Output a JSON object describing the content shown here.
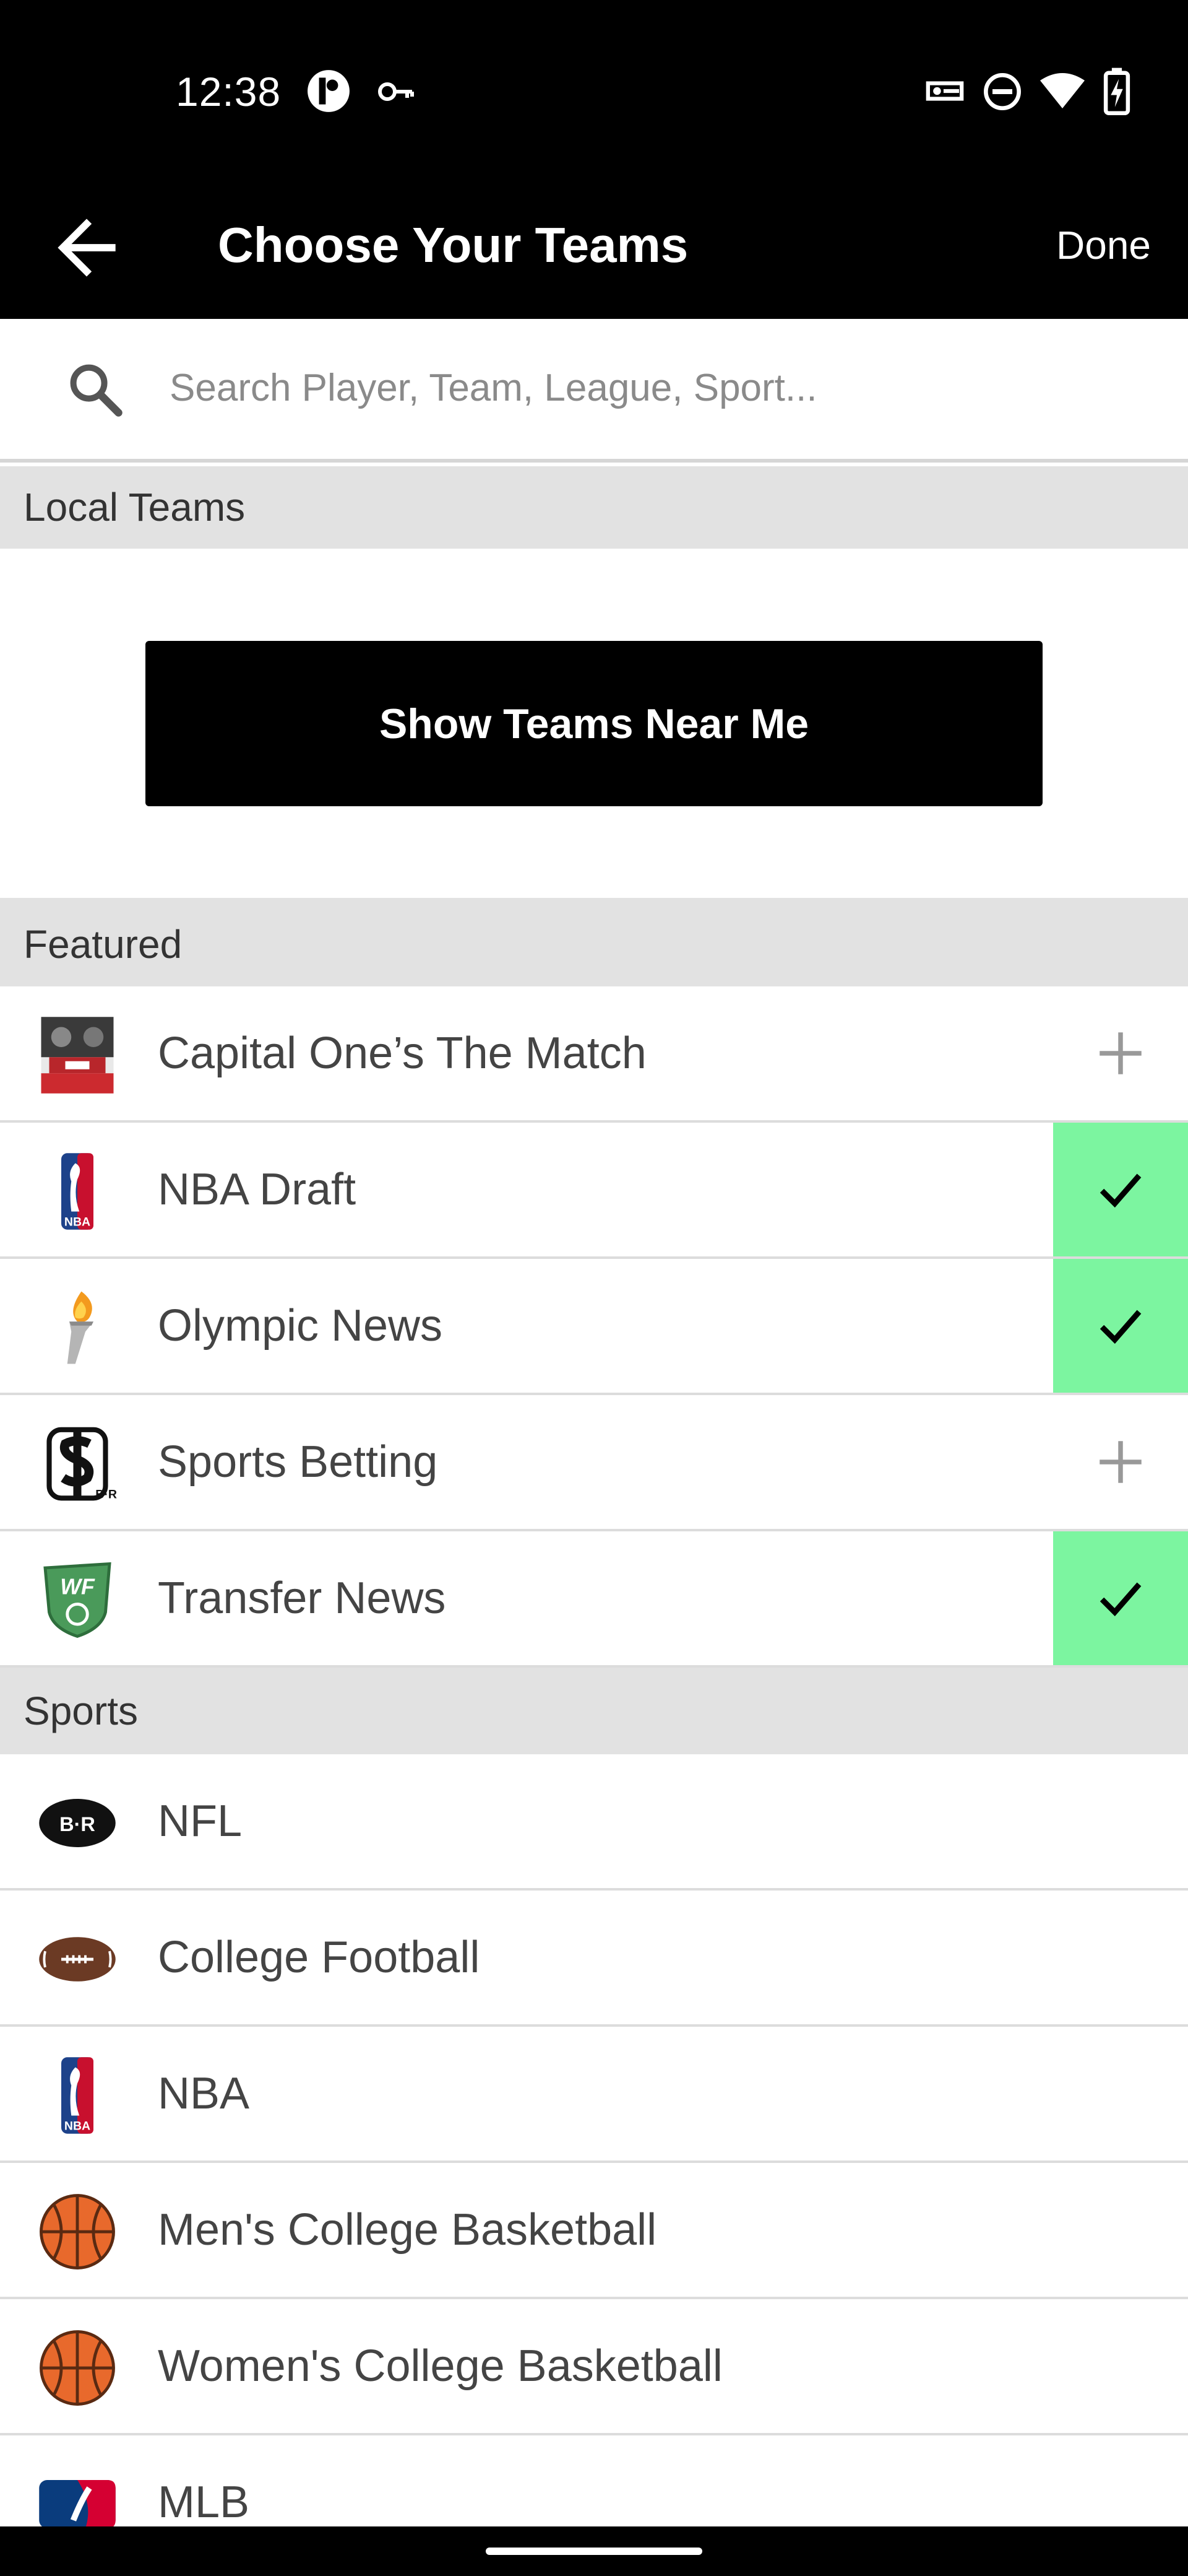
{
  "status_bar": {
    "time": "12:38"
  },
  "app_bar": {
    "title": "Choose Your Teams",
    "done_label": "Done"
  },
  "search": {
    "placeholder": "Search Player, Team, League, Sport..."
  },
  "local": {
    "header": "Local Teams",
    "button_label": "Show Teams Near Me"
  },
  "featured": {
    "header": "Featured",
    "items": [
      {
        "label": "Capital One’s The Match",
        "selected": false,
        "icon": "the-match-logo"
      },
      {
        "label": "NBA Draft",
        "selected": true,
        "icon": "nba-logo"
      },
      {
        "label": "Olympic News",
        "selected": true,
        "icon": "torch-icon"
      },
      {
        "label": "Sports Betting",
        "selected": false,
        "icon": "sports-betting-logo"
      },
      {
        "label": "Transfer News",
        "selected": true,
        "icon": "wf-shield-logo"
      }
    ]
  },
  "sports": {
    "header": "Sports",
    "items": [
      {
        "label": "NFL",
        "icon": "br-football-icon"
      },
      {
        "label": "College Football",
        "icon": "football-icon"
      },
      {
        "label": "NBA",
        "icon": "nba-logo"
      },
      {
        "label": "Men's College Basketball",
        "icon": "basketball-icon"
      },
      {
        "label": "Women's College Basketball",
        "icon": "basketball-icon"
      },
      {
        "label": "MLB",
        "icon": "mlb-logo"
      }
    ]
  },
  "colors": {
    "selected": "#7cf5a0",
    "bar": "#000000",
    "section": "#e2e2e2"
  }
}
